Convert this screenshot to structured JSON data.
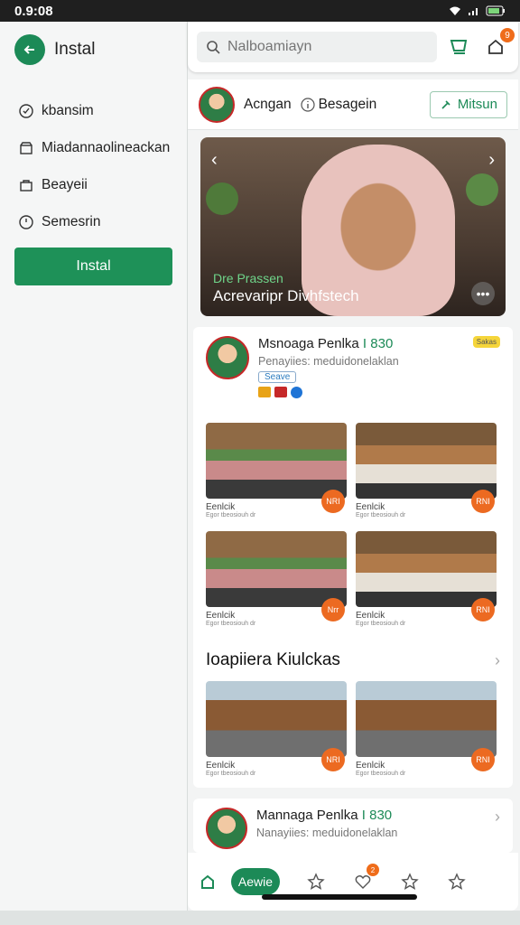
{
  "status": {
    "time": "0.9:08"
  },
  "drawer": {
    "title": "Instal",
    "items": [
      {
        "label": "kbansim",
        "icon": "check-circle-icon"
      },
      {
        "label": "Miadannaolineackan",
        "icon": "storefront-icon"
      },
      {
        "label": "Beayeii",
        "icon": "bag-icon"
      },
      {
        "label": "Semesrin",
        "icon": "clock-icon"
      }
    ],
    "cta": "Instal"
  },
  "search": {
    "placeholder": "Nalboamiayn",
    "notification_count": "9"
  },
  "profile": {
    "name": "Acngan",
    "sub": "Besagein",
    "follow_label": "Mitsun"
  },
  "hero": {
    "subtitle": "Dre Prassen",
    "title": "Acrevaripr Divhfstech"
  },
  "card1": {
    "name": "Msnoaga Penlka",
    "num": "I 830",
    "sub": "Penayiies: meduidonelaklan",
    "tag": "Seave",
    "badge": "Sakas",
    "thumbs": [
      {
        "cap1": "Eenlcik",
        "cap2": "Egor tbeosiouh dr",
        "count": "NRI"
      },
      {
        "cap1": "Eenlcik",
        "cap2": "Egor tbeosiouh dr",
        "count": "RNI"
      },
      {
        "cap1": "Eenlcik",
        "cap2": "Egor tbeosiouh dr",
        "count": "Nrr"
      },
      {
        "cap1": "Eenlcik",
        "cap2": "Egor tbeosiouh dr",
        "count": "RNI"
      }
    ]
  },
  "section": {
    "title": "Ioapiiera Kiulckas",
    "thumbs": [
      {
        "cap1": "Eenlcik",
        "cap2": "Egor tbeosiouh dr",
        "count": "NRI"
      },
      {
        "cap1": "Eenlcik",
        "cap2": "Egor tbeosiouh dr",
        "count": "RNI"
      }
    ]
  },
  "card2": {
    "name": "Mannaga Penlka",
    "num": "I 830",
    "sub": "Nanayiies: meduidonelaklan"
  },
  "bottombar": {
    "active_label": "Aewie",
    "badge": "2"
  },
  "colors": {
    "accent": "#1c8a57",
    "badge": "#ef6c1a"
  }
}
